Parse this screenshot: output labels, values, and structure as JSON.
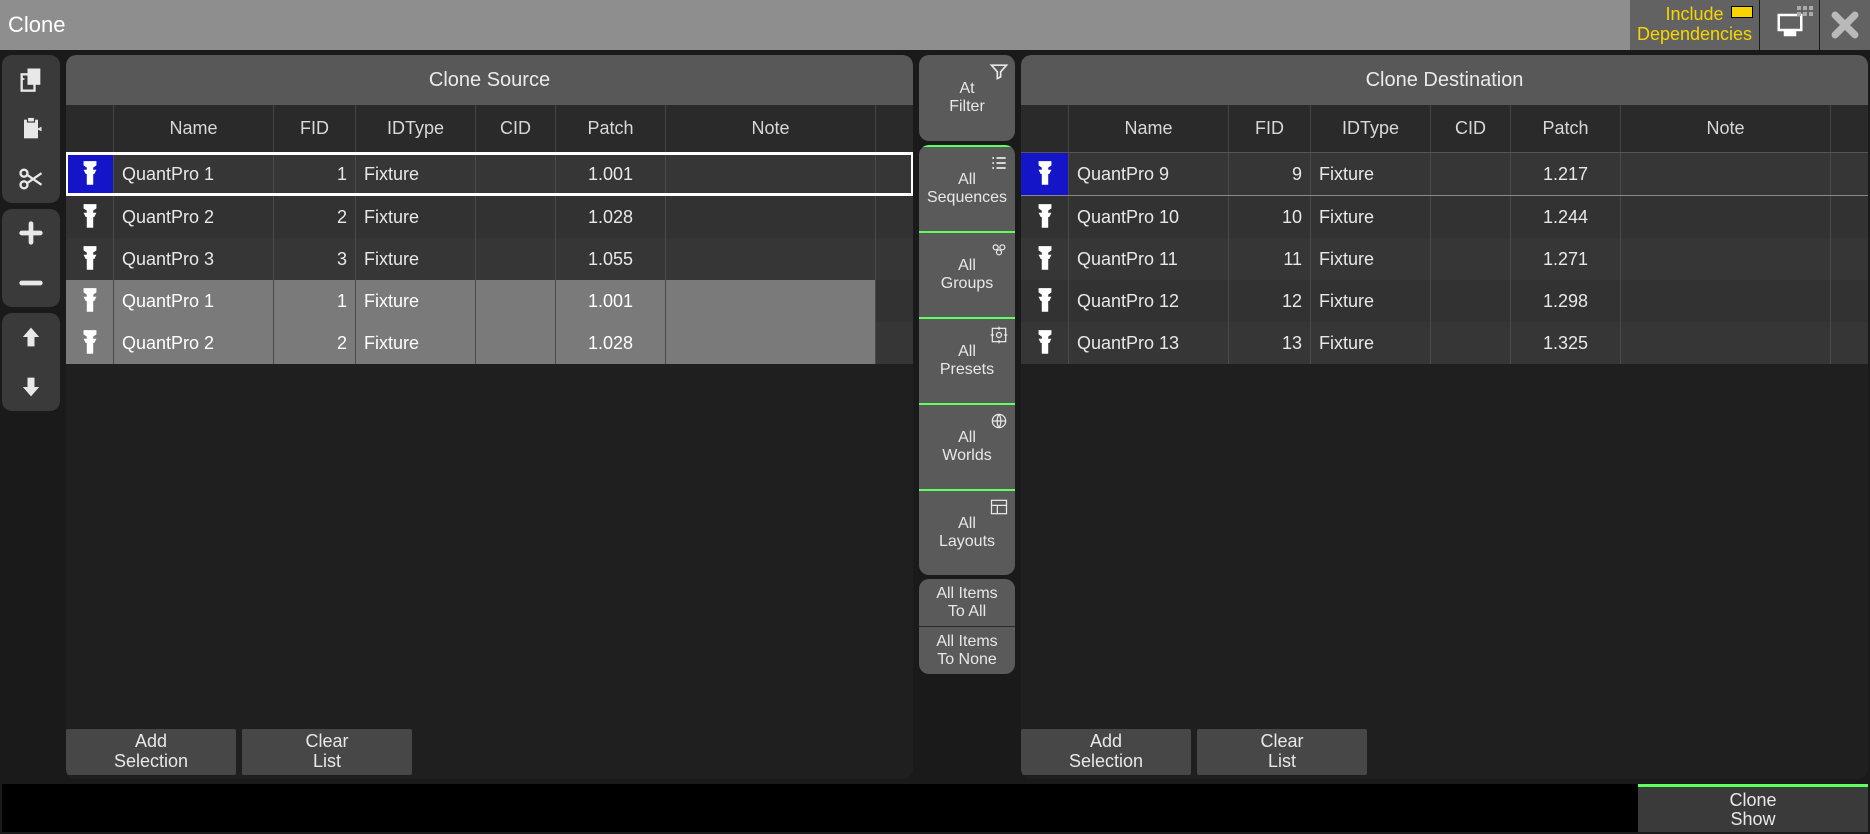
{
  "titlebar": {
    "title": "Clone",
    "include_deps": "Include Dependencies"
  },
  "source": {
    "header": "Clone Source",
    "columns": [
      "Name",
      "FID",
      "IDType",
      "CID",
      "Patch",
      "Note"
    ],
    "rows": [
      {
        "name": "QuantPro 1",
        "fid": "1",
        "idtype": "Fixture",
        "cid": "",
        "patch": "1.001",
        "note": "",
        "selected": true,
        "muted": false
      },
      {
        "name": "QuantPro 2",
        "fid": "2",
        "idtype": "Fixture",
        "cid": "",
        "patch": "1.028",
        "note": "",
        "selected": false,
        "muted": false
      },
      {
        "name": "QuantPro 3",
        "fid": "3",
        "idtype": "Fixture",
        "cid": "",
        "patch": "1.055",
        "note": "",
        "selected": false,
        "muted": false
      },
      {
        "name": "QuantPro 1",
        "fid": "1",
        "idtype": "Fixture",
        "cid": "",
        "patch": "1.001",
        "note": "",
        "selected": false,
        "muted": true
      },
      {
        "name": "QuantPro 2",
        "fid": "2",
        "idtype": "Fixture",
        "cid": "",
        "patch": "1.028",
        "note": "",
        "selected": false,
        "muted": true
      }
    ],
    "footer": {
      "add": "Add\nSelection",
      "clear": "Clear\nList"
    }
  },
  "destination": {
    "header": "Clone Destination",
    "columns": [
      "Name",
      "FID",
      "IDType",
      "CID",
      "Patch",
      "Note"
    ],
    "rows": [
      {
        "name": "QuantPro 9",
        "fid": "9",
        "idtype": "Fixture",
        "cid": "",
        "patch": "1.217",
        "note": "",
        "selected": true
      },
      {
        "name": "QuantPro 10",
        "fid": "10",
        "idtype": "Fixture",
        "cid": "",
        "patch": "1.244",
        "note": "",
        "selected": false
      },
      {
        "name": "QuantPro 11",
        "fid": "11",
        "idtype": "Fixture",
        "cid": "",
        "patch": "1.271",
        "note": "",
        "selected": false
      },
      {
        "name": "QuantPro 12",
        "fid": "12",
        "idtype": "Fixture",
        "cid": "",
        "patch": "1.298",
        "note": "",
        "selected": false
      },
      {
        "name": "QuantPro 13",
        "fid": "13",
        "idtype": "Fixture",
        "cid": "",
        "patch": "1.325",
        "note": "",
        "selected": false
      }
    ],
    "footer": {
      "add": "Add\nSelection",
      "clear": "Clear\nList"
    }
  },
  "mid": {
    "at_filter": "At\nFilter",
    "all_sequences": "All\nSequences",
    "all_groups": "All\nGroups",
    "all_presets": "All\nPresets",
    "all_worlds": "All\nWorlds",
    "all_layouts": "All\nLayouts",
    "all_items_to_all": "All Items\nTo All",
    "all_items_to_none": "All Items\nTo None"
  },
  "bottom": {
    "clone_show": "Clone\nShow"
  },
  "col_widths": {
    "icon": 48,
    "name": 160,
    "fid": 82,
    "idtype": 120,
    "cid": 80,
    "patch": 110,
    "note": 210
  }
}
